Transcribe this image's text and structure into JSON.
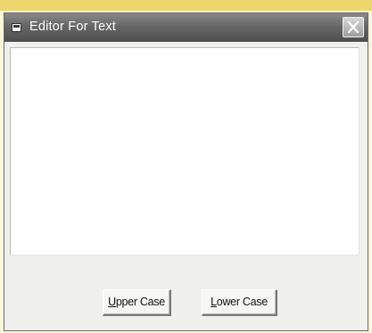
{
  "window": {
    "title": "Editor For Text",
    "title_bar_color": "#5a5a5a"
  },
  "icons": {
    "app": "window-app-icon",
    "close": "close-icon"
  },
  "editor": {
    "value": ""
  },
  "buttons": {
    "upper": {
      "hotkey": "U",
      "rest": "pper Case"
    },
    "lower": {
      "hotkey": "L",
      "rest": "ower Case"
    }
  }
}
